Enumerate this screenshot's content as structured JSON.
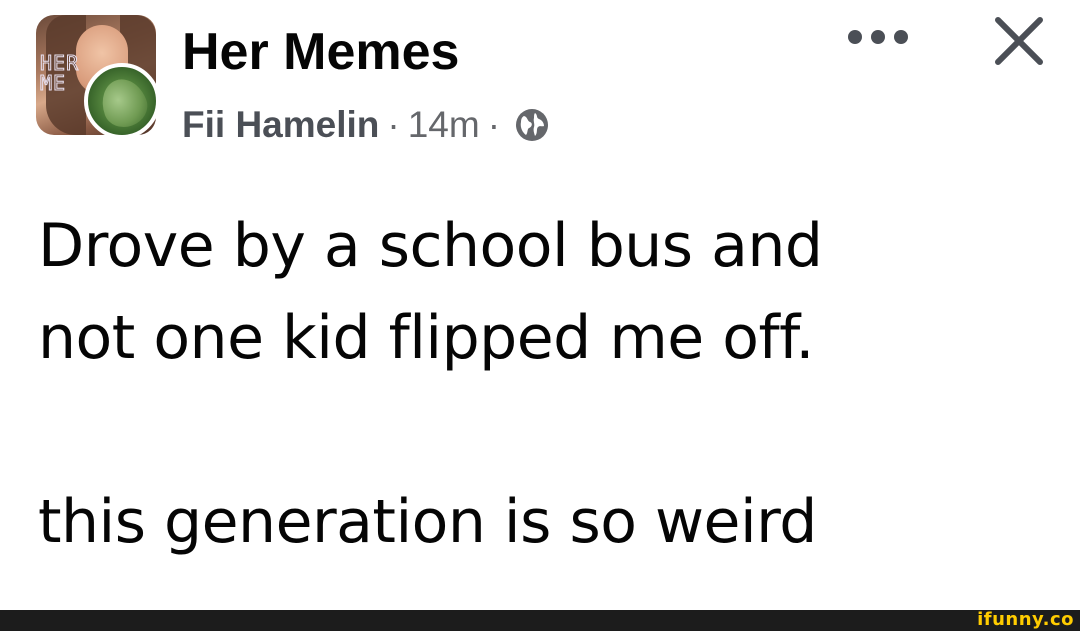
{
  "post": {
    "group_name": "Her Memes",
    "author": "Fii Hamelin",
    "separator": "·",
    "time": "14m",
    "privacy_icon": "globe-icon",
    "body_lines": [
      "Drove by a school bus and",
      "not one kid flipped me off.",
      "this generation is so weird"
    ]
  },
  "avatar": {
    "logo_text": "HER\nMEMES"
  },
  "icons": {
    "more": "more-options-icon",
    "close": "close-icon"
  },
  "colors": {
    "text": "#050505",
    "meta": "#65676b",
    "watermark": "#ffcc00"
  },
  "watermark": "ifunny.co"
}
